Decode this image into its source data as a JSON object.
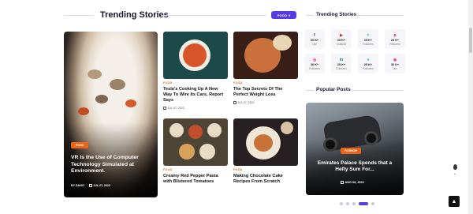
{
  "trending": {
    "title": "Trending Stories",
    "category_filter": "FOOD"
  },
  "featured": {
    "category": "FOOD",
    "title": "VR Is the Use of Computer Technology Simulated at Environment.",
    "author": "BY DAVID",
    "date": "JUL 07, 2022"
  },
  "posts": [
    {
      "category": "FOOD",
      "title": "Tesla's Cooking Up A New Way To Wire Its Cars, Report Says",
      "date": "JUL 07, 2022"
    },
    {
      "category": "FOOD",
      "title": "The Top Secrets Of The Perfect Weight Loss",
      "date": "JUL 07, 2022"
    },
    {
      "category": "FOOD",
      "title": "Creamy Red Pepper Pasta with Blistered Tomatoes",
      "date": "JUL 07, 2022"
    },
    {
      "category": "FOOD",
      "title": "Making Chocolate Cake Recipes From Scratch",
      "date": "JUL 07, 2022"
    }
  ],
  "sidebar": {
    "social_title": "Trending Stories",
    "social": [
      {
        "icon": "facebook-icon",
        "glyph": "f",
        "color": "#3b5998",
        "count": "30 K+",
        "label": "Like"
      },
      {
        "icon": "youtube-icon",
        "glyph": "▶",
        "color": "#e02424",
        "count": "25 K+",
        "label": "Subscrib"
      },
      {
        "icon": "twitter-icon",
        "glyph": "t",
        "color": "#1da1f2",
        "count": "25 K+",
        "label": "Followers"
      },
      {
        "icon": "pinterest-icon",
        "glyph": "p",
        "color": "#c8232c",
        "count": "25 K+",
        "label": "Followers"
      },
      {
        "icon": "instagram-icon",
        "glyph": "◎",
        "color": "#d6249f",
        "count": "30 K+",
        "label": "Followers"
      },
      {
        "icon": "linkedin-icon",
        "glyph": "in",
        "color": "#0a66c2",
        "count": "25 K+",
        "label": "Followers"
      },
      {
        "icon": "vimeo-icon",
        "glyph": "v",
        "color": "#1ab7ea",
        "count": "25 K+",
        "label": "Followers"
      },
      {
        "icon": "dribbble-icon",
        "glyph": "◉",
        "color": "#ea4c89",
        "count": "30 K+",
        "label": "Like"
      }
    ],
    "popular_title": "Popular Posts",
    "popular": {
      "category": "FASHION",
      "title": "Emirates Palace Spends that a Hefty Sum For...",
      "date": "AUG 08, 2022"
    }
  },
  "colors": {
    "accent": "#5a3be0",
    "category": "#e8651a"
  }
}
